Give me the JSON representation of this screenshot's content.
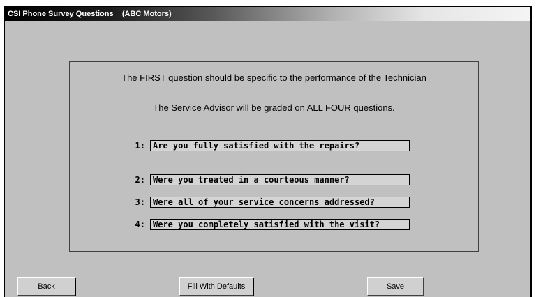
{
  "window": {
    "title": "CSI Phone Survey Questions    (ABC Motors)"
  },
  "panel": {
    "instruction_1": "The FIRST question should be specific to the performance of the Technician",
    "instruction_2": "The Service Advisor will be graded on ALL FOUR questions."
  },
  "questions": [
    {
      "number": "1:",
      "value": "Are you fully satisfied with the repairs?"
    },
    {
      "number": "2:",
      "value": "Were you treated in a courteous manner?"
    },
    {
      "number": "3:",
      "value": "Were all of your service concerns addressed?"
    },
    {
      "number": "4:",
      "value": "Were you completely satisfied with the visit?"
    }
  ],
  "buttons": {
    "back": "Back",
    "fill_defaults": "Fill With Defaults",
    "save": "Save"
  }
}
